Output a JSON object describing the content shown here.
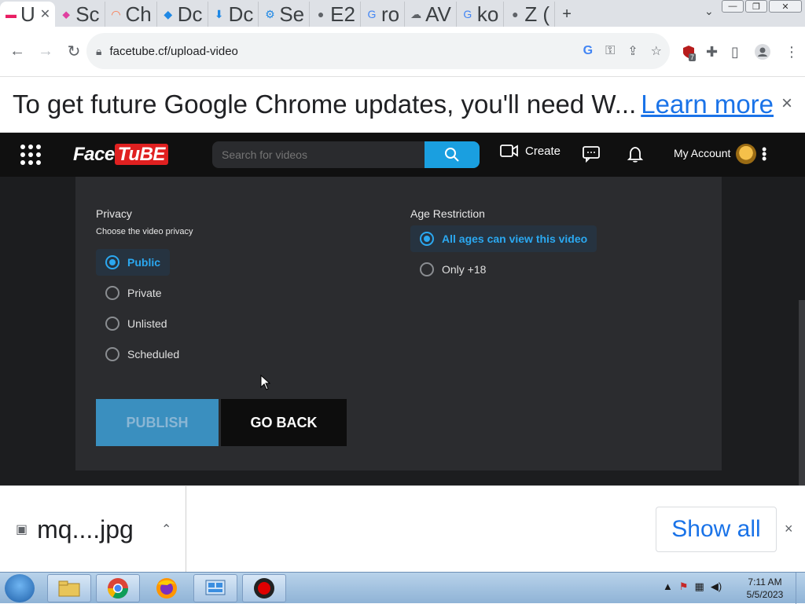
{
  "browser": {
    "tabs": [
      {
        "title": "U",
        "icon": "page-icon",
        "active": true
      },
      {
        "title": "Sc",
        "icon": "puzzle-icon"
      },
      {
        "title": "Ch",
        "icon": "rainbow-icon"
      },
      {
        "title": "Dc",
        "icon": "dropbox-icon"
      },
      {
        "title": "Dc",
        "icon": "download-icon"
      },
      {
        "title": "Se",
        "icon": "gear-icon"
      },
      {
        "title": "E2",
        "icon": "globe-icon"
      },
      {
        "title": "ro",
        "icon": "google-icon"
      },
      {
        "title": "AV",
        "icon": "cloud-icon"
      },
      {
        "title": "ko",
        "icon": "google-icon"
      },
      {
        "title": "Z (",
        "icon": "globe-icon"
      }
    ],
    "new_tab": "+",
    "url": "facetube.cf/upload-video",
    "extension_badge": "7"
  },
  "banner": {
    "message": "To get future Google Chrome updates, you'll need W...",
    "link": "Learn more",
    "close": "×"
  },
  "site": {
    "logo_face": "Face",
    "logo_tube": "TuBE",
    "search_placeholder": "Search for videos",
    "create": "Create",
    "account": "My Account"
  },
  "form": {
    "privacy": {
      "label": "Privacy",
      "sublabel": "Choose the video privacy",
      "options": [
        "Public",
        "Private",
        "Unlisted",
        "Scheduled"
      ],
      "selected": "Public"
    },
    "age": {
      "label": "Age Restriction",
      "options": [
        "All ages can view this video",
        "Only +18"
      ],
      "selected": "All ages can view this video"
    },
    "publish": "PUBLISH",
    "go_back": "GO BACK"
  },
  "downloads": {
    "file_name": "mq....jpg",
    "show_all": "Show all",
    "close": "×"
  },
  "taskbar": {
    "time": "7:11 AM",
    "date": "5/5/2023"
  },
  "colors": {
    "accent": "#2ba8f0",
    "search_button": "#1a9fe0",
    "publish_button": "#3a8fbf",
    "logo_red": "#e02020"
  }
}
